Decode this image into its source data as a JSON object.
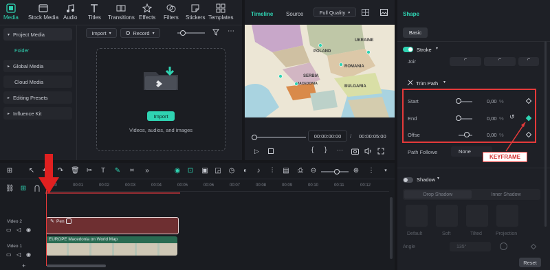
{
  "toolbar": {
    "tabs": [
      {
        "label": "Media",
        "icon": "media-icon"
      },
      {
        "label": "Stock Media",
        "icon": "stock-media-icon"
      },
      {
        "label": "Audio",
        "icon": "audio-icon"
      },
      {
        "label": "Titles",
        "icon": "titles-icon"
      },
      {
        "label": "Transitions",
        "icon": "transitions-icon"
      },
      {
        "label": "Effects",
        "icon": "effects-icon"
      },
      {
        "label": "Filters",
        "icon": "filters-icon"
      },
      {
        "label": "Stickers",
        "icon": "stickers-icon"
      },
      {
        "label": "Templates",
        "icon": "templates-icon"
      }
    ]
  },
  "sidebar": {
    "items": [
      {
        "label": "Project Media"
      },
      {
        "label": "Folder"
      },
      {
        "label": "Global Media"
      },
      {
        "label": "Cloud Media"
      },
      {
        "label": "Editing Presets"
      },
      {
        "label": "Influence Kit"
      }
    ]
  },
  "media": {
    "import_label": "Import",
    "record_label": "Record",
    "drop_button": "Import",
    "drop_hint": "Videos, audios, and images"
  },
  "preview": {
    "tab_timeline": "Timeline",
    "tab_source": "Source",
    "quality": "Full Quality",
    "map_labels": [
      "POLAND",
      "UKRAINE",
      "ROMANIA",
      "BULGARIA",
      "SERBIA",
      "MACEDONIA"
    ],
    "time_current": "00:00:00:00",
    "time_total": "00:00:05:00"
  },
  "properties": {
    "header": "Shape",
    "tab_basic": "Basic",
    "stroke_label": "Stroke",
    "join_label": "Joir",
    "trim_path_label": "Trim Path",
    "rows": [
      {
        "label": "Start",
        "value": "0,00",
        "unit": "%"
      },
      {
        "label": "End",
        "value": "0,00",
        "unit": "%"
      },
      {
        "label": "Offse",
        "value": "0,00",
        "unit": "%"
      }
    ],
    "path_follow_label": "Path Followe",
    "path_follow_value": "None",
    "keyframe_callout": "KEYFRAME",
    "shadow_label": "Shadow",
    "shadow_tabs": [
      "Drop Shadow",
      "Inner Shadow"
    ],
    "shadow_presets": [
      "Default",
      "Soft",
      "Tilted",
      "Projection"
    ],
    "angle_label": "Angle",
    "angle_value": "135°",
    "reset_label": "Reset"
  },
  "timeline": {
    "ticks": [
      "00:00",
      "00:01",
      "00:02",
      "00:03",
      "00:04",
      "00:05",
      "00:06",
      "00:07",
      "00:08",
      "00:09",
      "00:10",
      "00:11",
      "00:12"
    ],
    "tracks": [
      {
        "label": "Video 2",
        "clip": "Pen"
      },
      {
        "label": "Video 1",
        "clip": "EUROPE Macedonia on World Map"
      }
    ]
  },
  "colors": {
    "accent": "#2fd3b2",
    "highlight": "#e53a3a",
    "clip_pen": "#6e2f31",
    "clip_video": "#2a6b52"
  }
}
